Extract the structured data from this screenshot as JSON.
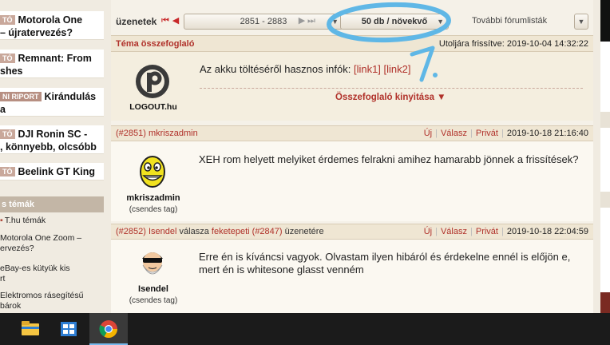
{
  "left_sidebar": {
    "news": [
      {
        "tag": "TÓ",
        "title": "Motorola One\n– újratervezés?"
      },
      {
        "tag": "TÓ",
        "title": "Remnant: From\nshes"
      },
      {
        "tag": "NI RIPORT",
        "title": "Kirándulás a\nn-tó völgyében"
      },
      {
        "tag": "TÓ",
        "title": "DJI Ronin SC -\n, könnyebb, olcsóbb"
      },
      {
        "tag": "TÓ",
        "title": "Beelink GT King"
      }
    ],
    "topics_header": "s témák",
    "topics": [
      "T.hu témák",
      "Motorola One Zoom –\nervezés?",
      "eBay-es kütyük kis\nrt",
      "Elektromos rásegítésű\nbárok"
    ]
  },
  "toolbar": {
    "label": "üzenetek",
    "range": "2851 - 2883",
    "sort": "50 db / növekvő",
    "more": "További fórumlisták"
  },
  "summary": {
    "title": "Téma összefoglaló",
    "updated": "Utoljára frissítve: 2019-10-04 14:32:22",
    "logo_name": "LOGOUT.hu",
    "text": "Az akku töltéséről hasznos infók:",
    "link1": "[link1]",
    "link2": "[link2]",
    "expand": "Összefoglaló kinyitása ▼"
  },
  "posts": [
    {
      "number": "(#2851)",
      "author": "mkriszadmin",
      "reply_text": "",
      "reply_to": "",
      "reply_num": "",
      "reply_suffix": "",
      "actions": [
        "Új",
        "Válasz",
        "Privát"
      ],
      "date": "2019-10-18 21:16:40",
      "username": "mkriszadmin",
      "rank": "(csendes tag)",
      "text": "XEH rom helyett melyiket érdemes felrakni amihez hamarabb jönnek a frissítések?"
    },
    {
      "number": "(#2852)",
      "author": "Isendel",
      "reply_text": "válasza",
      "reply_to": "feketepeti",
      "reply_num": "(#2847)",
      "reply_suffix": "üzenetére",
      "actions": [
        "Új",
        "Válasz",
        "Privát"
      ],
      "date": "2019-10-18 22:04:59",
      "username": "Isendel",
      "rank": "(csendes tag)",
      "text": "Erre én is kíváncsi vagyok. Olvastam ilyen hibáról és érdekelne ennél is előjön e, mert én is whitesone glasst venném"
    }
  ],
  "annotation": {
    "label": "1.",
    "color": "#5fb7e6"
  },
  "colors": {
    "accent": "#b0312a",
    "header_bg": "#efe6d3",
    "taskbar": "#1b1b1b"
  },
  "icons": [
    "first-page-icon",
    "prev-page-icon",
    "next-page-icon",
    "last-page-icon",
    "dropdown-caret-icon",
    "logout-logo-icon",
    "smiley-avatar-icon",
    "sunglasses-avatar-icon",
    "file-explorer-icon",
    "store-icon",
    "chrome-icon"
  ]
}
